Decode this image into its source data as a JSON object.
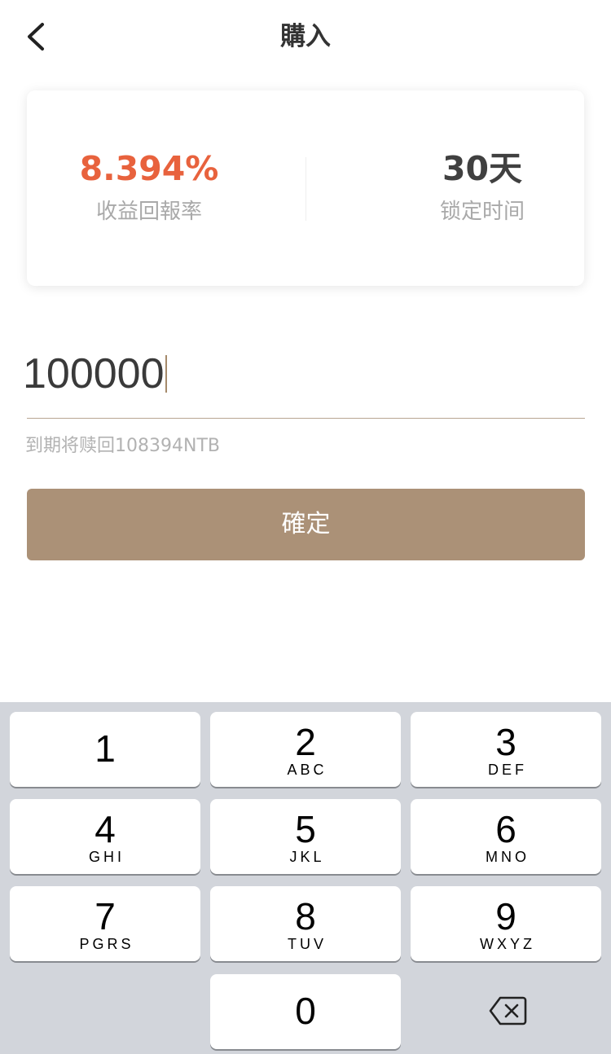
{
  "header": {
    "back_icon": "chevron-left-icon",
    "title": "購入"
  },
  "card": {
    "rate_value": "8.394%",
    "rate_label": "收益回報率",
    "lock_value": "30天",
    "lock_label": "锁定时间",
    "colors": {
      "rate": "#e8623d",
      "days": "#404040"
    }
  },
  "amount": {
    "value": "100000"
  },
  "hint": "到期将赎回108394NTB",
  "confirm_label": "確定",
  "accent_color": "#ab9177",
  "keyboard": {
    "keys": [
      {
        "digit": "1",
        "letters": ""
      },
      {
        "digit": "2",
        "letters": "ABC"
      },
      {
        "digit": "3",
        "letters": "DEF"
      },
      {
        "digit": "4",
        "letters": "GHI"
      },
      {
        "digit": "5",
        "letters": "JKL"
      },
      {
        "digit": "6",
        "letters": "MNO"
      },
      {
        "digit": "7",
        "letters": "PGRS"
      },
      {
        "digit": "8",
        "letters": "TUV"
      },
      {
        "digit": "9",
        "letters": "WXYZ"
      },
      {
        "digit": "0",
        "letters": ""
      }
    ],
    "delete_icon": "backspace-icon"
  }
}
